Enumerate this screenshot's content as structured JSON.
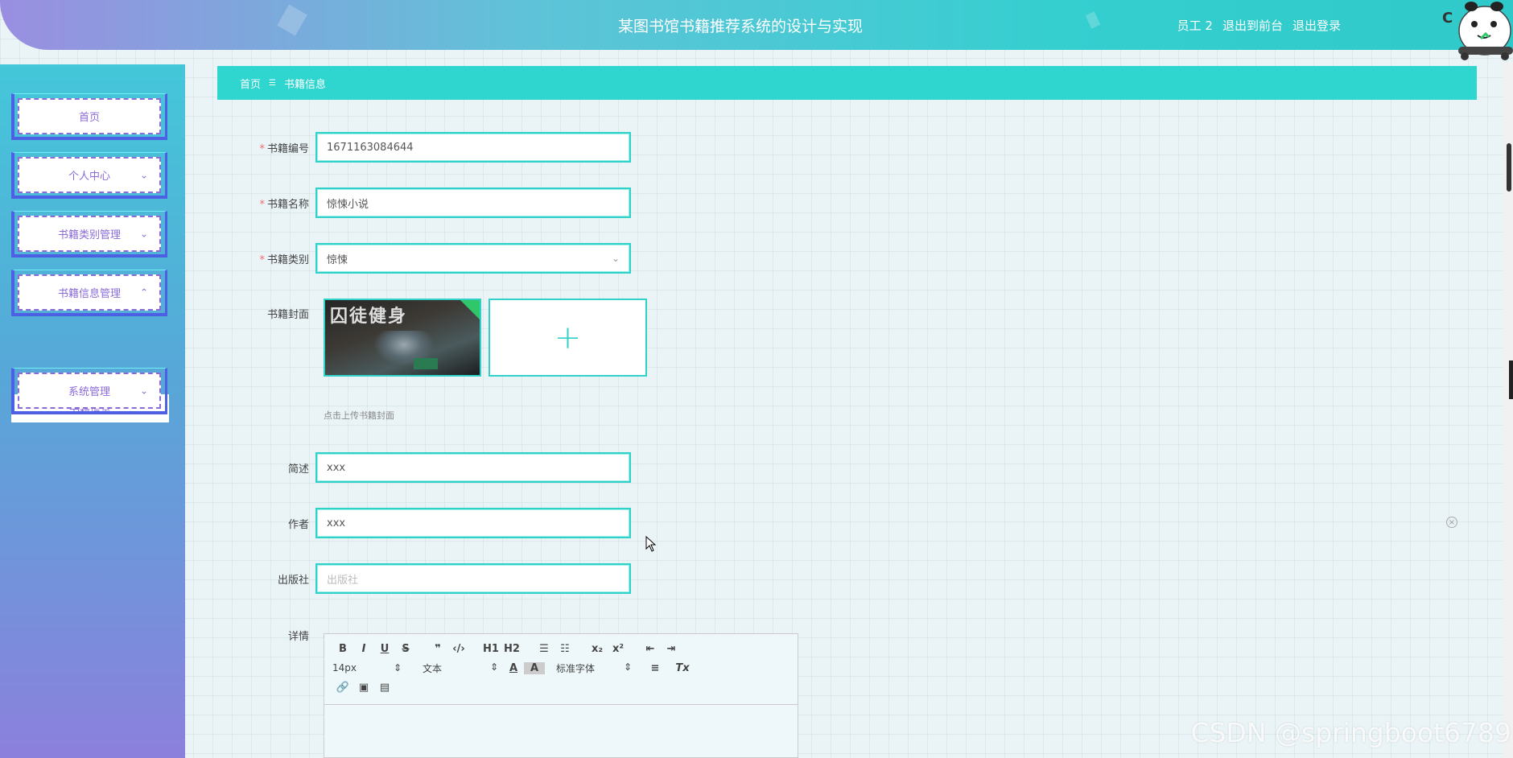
{
  "header": {
    "title": "某图书馆书籍推荐系统的设计与实现",
    "user": "员工 2",
    "front_label": "退出到前台",
    "logout_label": "退出登录",
    "avatar_text": "C"
  },
  "sidebar": {
    "items": [
      {
        "label": "首页",
        "has_arrow": false
      },
      {
        "label": "个人中心",
        "has_arrow": true,
        "arrow": "⌄"
      },
      {
        "label": "书籍类别管理",
        "has_arrow": true,
        "arrow": "⌄"
      },
      {
        "label": "书籍信息管理",
        "has_arrow": true,
        "arrow": "⌃"
      },
      {
        "label": "系统管理",
        "has_arrow": true,
        "arrow": "⌄"
      }
    ],
    "sub_item": "书籍信息"
  },
  "breadcrumb": {
    "home": "首页",
    "separator": "☰",
    "current": "书籍信息"
  },
  "form": {
    "required_mark": "*",
    "book_no": {
      "label": "书籍编号",
      "value": "1671163084644"
    },
    "book_name": {
      "label": "书籍名称",
      "value": "惊悚小说"
    },
    "category": {
      "label": "书籍类别",
      "value": "惊悚",
      "arrow": "⌄"
    },
    "cover": {
      "label": "书籍封面",
      "title_art": "囚徒健身",
      "add_icon": "+",
      "hint": "点击上传书籍封面"
    },
    "summary": {
      "label": "简述",
      "value": "xxx"
    },
    "author": {
      "label": "作者",
      "value": "xxx"
    },
    "publisher": {
      "label": "出版社",
      "placeholder": "出版社"
    },
    "details": {
      "label": "详情"
    }
  },
  "editor": {
    "row1": [
      "B",
      "I",
      "U",
      "S",
      "❞",
      "‹/›",
      "H1",
      "H2",
      "☰",
      "☷",
      "x₂",
      "x²",
      "⇤",
      "⇥"
    ],
    "size_select": "14px",
    "text_select": "文本",
    "font_select": "标准字体",
    "color_icon": "A",
    "bg_icon": "A",
    "align_icon": "≡",
    "clear_icon": "Tx",
    "select_arrow": "⇕",
    "row3": [
      "🔗",
      "▣",
      "▤"
    ]
  },
  "watermark": "CSDN @springboot6789",
  "close_icon": "×",
  "colors": {
    "accent": "#2fd6cf",
    "sidebar_text": "#8a6bd8",
    "required": "#f56c6c"
  }
}
